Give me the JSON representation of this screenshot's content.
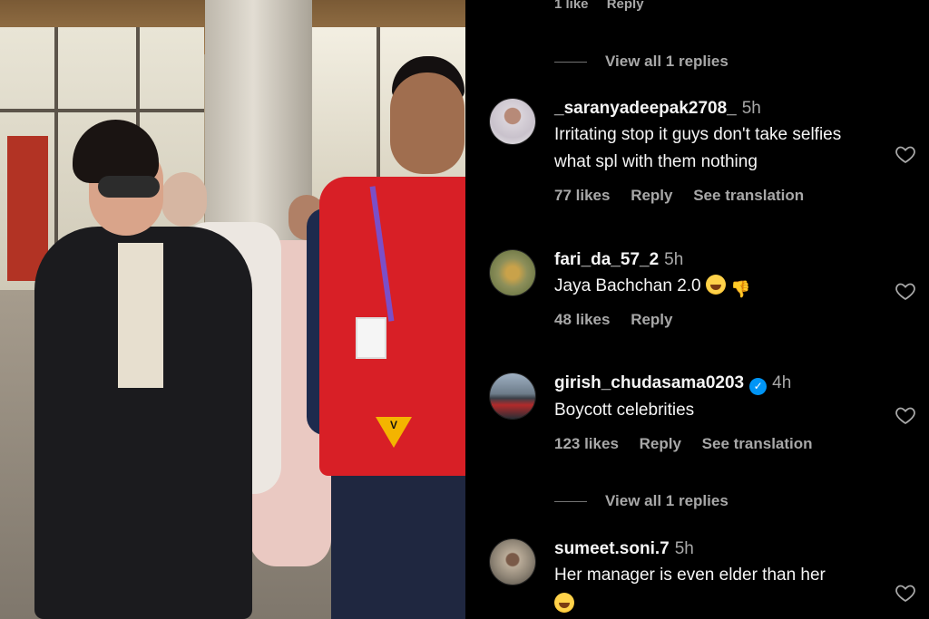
{
  "partial_top": {
    "likes": "1 like",
    "reply": "Reply"
  },
  "view_replies_1": {
    "label": "View all 1 replies"
  },
  "view_replies_2": {
    "label": "View all 1 replies"
  },
  "comments": [
    {
      "username": "_saranyadeepak2708_",
      "time": "5h",
      "text": "Irritating stop it guys don't take selfies what spl with them nothing",
      "likes": "77 likes",
      "reply": "Reply",
      "translation": "See translation",
      "verified": false
    },
    {
      "username": "fari_da_57_2",
      "time": "5h",
      "text": "Jaya Bachchan 2.0",
      "likes": "48 likes",
      "reply": "Reply",
      "verified": false
    },
    {
      "username": "girish_chudasama0203",
      "time": "4h",
      "text": "Boycott celebrities",
      "likes": "123 likes",
      "reply": "Reply",
      "translation": "See translation",
      "verified": true
    },
    {
      "username": "sumeet.soni.7",
      "time": "5h",
      "text": "Her manager is even elder than her",
      "verified": false
    }
  ],
  "photo": {
    "watermark_text": "V"
  },
  "colors": {
    "background": "#000000",
    "text_primary": "#f5f5f5",
    "text_secondary": "#a8a8a8",
    "verified_blue": "#0095f6",
    "vest_red": "#d81f26"
  },
  "icons": [
    "heart-icon",
    "verified-icon",
    "laughing-emoji-icon",
    "thumbs-down-emoji-icon"
  ]
}
